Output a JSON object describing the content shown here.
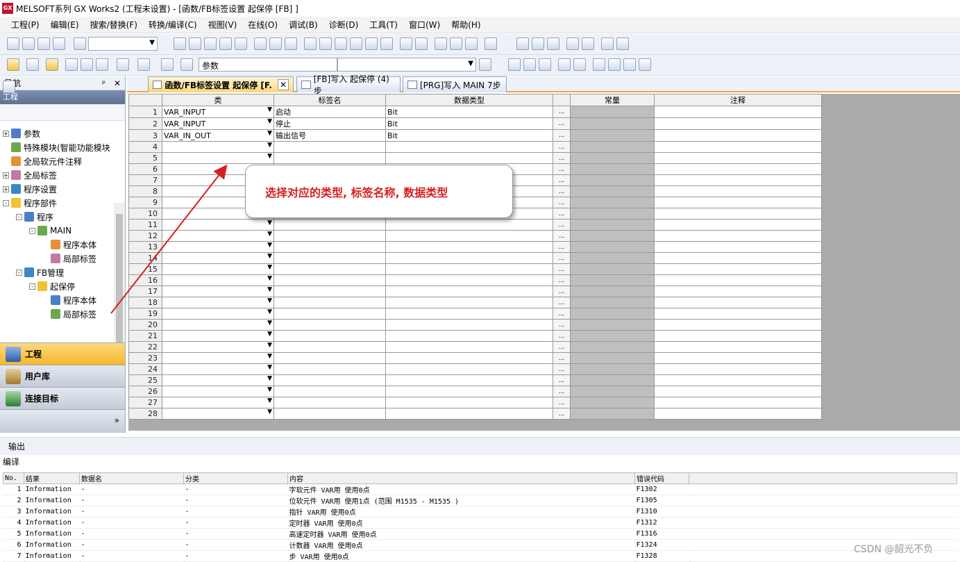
{
  "window": {
    "title": "MELSOFT系列 GX Works2 (工程未设置) - [函数/FB标签设置 起保停 [FB] ]",
    "app_icon": "GX"
  },
  "menu": [
    "工程(P)",
    "编辑(E)",
    "搜索/替换(F)",
    "转换/编译(C)",
    "视图(V)",
    "在线(O)",
    "调试(B)",
    "诊断(D)",
    "工具(T)",
    "窗口(W)",
    "帮助(H)"
  ],
  "toolbar2": {
    "combo1": "参数",
    "combo2": ""
  },
  "nav": {
    "title": "导航",
    "pin": "ᵖ",
    "close": "✕",
    "project_header": "工程",
    "tree": [
      {
        "label": "参数",
        "level": 0,
        "exp": "+"
      },
      {
        "label": "特殊模块(智能功能模块",
        "level": 0,
        "exp": ""
      },
      {
        "label": "全局软元件注释",
        "level": 0,
        "exp": ""
      },
      {
        "label": "全局标签",
        "level": 0,
        "exp": "+"
      },
      {
        "label": "程序设置",
        "level": 0,
        "exp": "+"
      },
      {
        "label": "程序部件",
        "level": 0,
        "exp": "-"
      },
      {
        "label": "程序",
        "level": 1,
        "exp": "-"
      },
      {
        "label": "MAIN",
        "level": 2,
        "exp": "-"
      },
      {
        "label": "程序本体",
        "level": 3,
        "exp": ""
      },
      {
        "label": "局部标签",
        "level": 3,
        "exp": ""
      },
      {
        "label": "FB管理",
        "level": 1,
        "exp": "-"
      },
      {
        "label": "起保停",
        "level": 2,
        "exp": "-"
      },
      {
        "label": "程序本体",
        "level": 3,
        "exp": ""
      },
      {
        "label": "局部标签",
        "level": 3,
        "exp": ""
      }
    ],
    "buttons": [
      "工程",
      "用户库",
      "连接目标"
    ],
    "more": "»"
  },
  "tabs": [
    {
      "label": "函数/FB标签设置 起保停 [F...",
      "active": true,
      "close": "✕"
    },
    {
      "label": "[FB]写入 起保停 (4)步",
      "active": false
    },
    {
      "label": "[PRG]写入 MAIN 7步",
      "active": false
    }
  ],
  "grid": {
    "headers": [
      "类",
      "标签名",
      "数据类型",
      "",
      "常量",
      "注释"
    ],
    "rows": [
      {
        "n": "1",
        "cls": "VAR_INPUT",
        "name": "启动",
        "type": "Bit"
      },
      {
        "n": "2",
        "cls": "VAR_INPUT",
        "name": "停止",
        "type": "Bit"
      },
      {
        "n": "3",
        "cls": "VAR_IN_OUT",
        "name": "输出信号",
        "type": "Bit"
      },
      {
        "n": "4",
        "cls": "",
        "name": "",
        "type": ""
      },
      {
        "n": "5",
        "cls": "",
        "name": "",
        "type": ""
      },
      {
        "n": "6",
        "cls": "",
        "name": "",
        "type": ""
      },
      {
        "n": "7",
        "cls": "",
        "name": "",
        "type": ""
      },
      {
        "n": "8",
        "cls": "",
        "name": "",
        "type": ""
      },
      {
        "n": "9",
        "cls": "",
        "name": "",
        "type": ""
      },
      {
        "n": "10",
        "cls": "",
        "name": "",
        "type": ""
      },
      {
        "n": "11",
        "cls": "",
        "name": "",
        "type": ""
      },
      {
        "n": "12",
        "cls": "",
        "name": "",
        "type": ""
      },
      {
        "n": "13",
        "cls": "",
        "name": "",
        "type": ""
      },
      {
        "n": "14",
        "cls": "",
        "name": "",
        "type": ""
      },
      {
        "n": "15",
        "cls": "",
        "name": "",
        "type": ""
      },
      {
        "n": "16",
        "cls": "",
        "name": "",
        "type": ""
      },
      {
        "n": "17",
        "cls": "",
        "name": "",
        "type": ""
      },
      {
        "n": "18",
        "cls": "",
        "name": "",
        "type": ""
      },
      {
        "n": "19",
        "cls": "",
        "name": "",
        "type": ""
      },
      {
        "n": "20",
        "cls": "",
        "name": "",
        "type": ""
      },
      {
        "n": "21",
        "cls": "",
        "name": "",
        "type": ""
      },
      {
        "n": "22",
        "cls": "",
        "name": "",
        "type": ""
      },
      {
        "n": "23",
        "cls": "",
        "name": "",
        "type": ""
      },
      {
        "n": "24",
        "cls": "",
        "name": "",
        "type": ""
      },
      {
        "n": "25",
        "cls": "",
        "name": "",
        "type": ""
      },
      {
        "n": "26",
        "cls": "",
        "name": "",
        "type": ""
      },
      {
        "n": "27",
        "cls": "",
        "name": "",
        "type": ""
      },
      {
        "n": "28",
        "cls": "",
        "name": "",
        "type": ""
      }
    ],
    "ellipsis": "..."
  },
  "callout": "选择对应的类型, 标签名称, 数据类型",
  "output": {
    "title": "输出",
    "section": "编译",
    "headers": [
      "No.",
      "结果",
      "数据名",
      "分类",
      "内容",
      "错误代码"
    ],
    "rows": [
      {
        "no": "1",
        "result": "Information",
        "data": "-",
        "cat": "-",
        "content": "字软元件 VAR用 使用0点",
        "code": "F1302"
      },
      {
        "no": "2",
        "result": "Information",
        "data": "-",
        "cat": "-",
        "content": "位软元件 VAR用 使用1点 (范围 M1535 - M1535 )",
        "code": "F1305"
      },
      {
        "no": "3",
        "result": "Information",
        "data": "-",
        "cat": "-",
        "content": "指针 VAR用 使用0点",
        "code": "F1310"
      },
      {
        "no": "4",
        "result": "Information",
        "data": "-",
        "cat": "-",
        "content": "定时器 VAR用 使用0点",
        "code": "F1312"
      },
      {
        "no": "5",
        "result": "Information",
        "data": "-",
        "cat": "-",
        "content": "高速定时器 VAR用 使用0点",
        "code": "F1316"
      },
      {
        "no": "6",
        "result": "Information",
        "data": "-",
        "cat": "-",
        "content": "计数器 VAR用 使用0点",
        "code": "F1324"
      },
      {
        "no": "7",
        "result": "Information",
        "data": "-",
        "cat": "-",
        "content": "步 VAR用 使用0点",
        "code": "F1328"
      }
    ]
  },
  "watermark": "CSDN @韶光不负",
  "colors": {
    "callout_text": "#d81e1e",
    "arrow": "#d81e1e",
    "active_tab": "#fbd77c",
    "const_col": "#bfbfbf"
  }
}
